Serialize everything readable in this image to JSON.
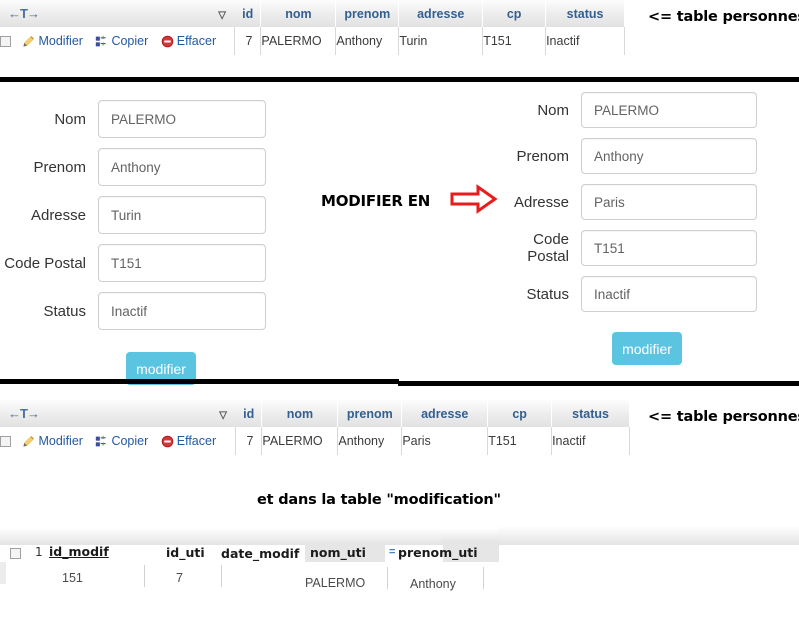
{
  "tables": {
    "personnes_top": {
      "nav_icon": "table-nav-icon",
      "sort_icon": "caret-down-icon",
      "columns": [
        "id",
        "nom",
        "prenom",
        "adresse",
        "cp",
        "status"
      ],
      "actions": [
        "Modifier",
        "Copier",
        "Effacer"
      ],
      "row": {
        "id": "7",
        "nom": "PALERMO",
        "prenom": "Anthony",
        "adresse": "Turin",
        "cp": "T151",
        "status": "Inactif"
      },
      "annotation": "<= table personnes"
    },
    "personnes_bottom": {
      "nav_icon": "table-nav-icon",
      "sort_icon": "caret-down-icon",
      "columns": [
        "id",
        "nom",
        "prenom",
        "adresse",
        "cp",
        "status"
      ],
      "actions": [
        "Modifier",
        "Copier",
        "Effacer"
      ],
      "row": {
        "id": "7",
        "nom": "PALERMO",
        "prenom": "Anthony",
        "adresse": "Paris",
        "cp": "T151",
        "status": "Inactif"
      },
      "annotation": "<= table personnes"
    },
    "modification": {
      "caption": "et dans la table \"modification\"",
      "row_number": "1",
      "columns": [
        "id_modif",
        "id_uti",
        "date_modif",
        "nom_uti",
        "prenom_uti"
      ],
      "row": {
        "id_modif": "151",
        "id_uti": "7",
        "date_modif": "",
        "nom_uti": "PALERMO",
        "prenom_uti": "Anthony"
      }
    }
  },
  "forms": {
    "before": {
      "fields": [
        {
          "label": "Nom",
          "value": "PALERMO"
        },
        {
          "label": "Prenom",
          "value": "Anthony"
        },
        {
          "label": "Adresse",
          "value": "Turin"
        },
        {
          "label": "Code Postal",
          "value": "T151"
        },
        {
          "label": "Status",
          "value": "Inactif"
        }
      ],
      "submit_label": "modifier"
    },
    "after": {
      "fields": [
        {
          "label": "Nom",
          "value": "PALERMO"
        },
        {
          "label": "Prenom",
          "value": "Anthony"
        },
        {
          "label": "Adresse",
          "value": "Paris"
        },
        {
          "label": "Code Postal",
          "value": "T151"
        },
        {
          "label": "Status",
          "value": "Inactif"
        }
      ],
      "submit_label": "modifier"
    }
  },
  "middle": {
    "label": "MODIFIER EN",
    "arrow_icon": "right-arrow-icon",
    "arrow_color": "#e81c1c"
  },
  "colors": {
    "header_text": "#355f8e",
    "link": "#235a9e",
    "button": "#5bc4e0",
    "annotation": "#000000"
  }
}
